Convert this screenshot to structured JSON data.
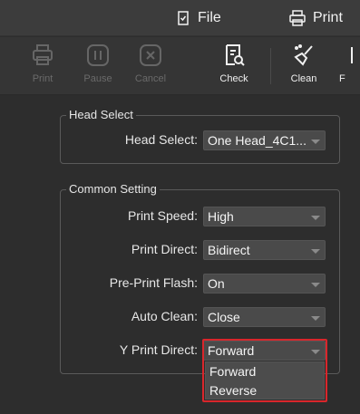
{
  "menubar": {
    "file_label": "File",
    "file_icon": "file-shield-icon",
    "print_label": "Print",
    "print_icon": "printer-icon"
  },
  "toolbar": {
    "items": [
      {
        "label": "Print",
        "icon": "printer-icon",
        "enabled": false
      },
      {
        "label": "Pause",
        "icon": "pause-icon",
        "enabled": false
      },
      {
        "label": "Cancel",
        "icon": "cancel-icon",
        "enabled": false
      },
      {
        "label": "Check",
        "icon": "check-document-icon",
        "enabled": true
      },
      {
        "label": "Clean",
        "icon": "clean-brush-icon",
        "enabled": true
      },
      {
        "label": "F",
        "icon": "more-tool-icon",
        "enabled": true
      }
    ]
  },
  "head_select": {
    "title": "Head Select",
    "label": "Head Select:",
    "value": "One Head_4C1..."
  },
  "common_setting": {
    "title": "Common Setting",
    "print_speed": {
      "label": "Print Speed:",
      "value": "High"
    },
    "print_direct": {
      "label": "Print Direct:",
      "value": "Bidirect"
    },
    "pre_print_flash": {
      "label": "Pre-Print Flash:",
      "value": "On"
    },
    "auto_clean": {
      "label": "Auto Clean:",
      "value": "Close"
    },
    "y_print_direct": {
      "label": "Y Print Direct:",
      "value": "Forward"
    }
  },
  "y_print_direct_dropdown": {
    "options": [
      "Forward",
      "Reverse"
    ]
  },
  "colors": {
    "highlight": "#d9262b",
    "background": "#2d2d2d",
    "disabled_text": "#6a6a6a"
  }
}
